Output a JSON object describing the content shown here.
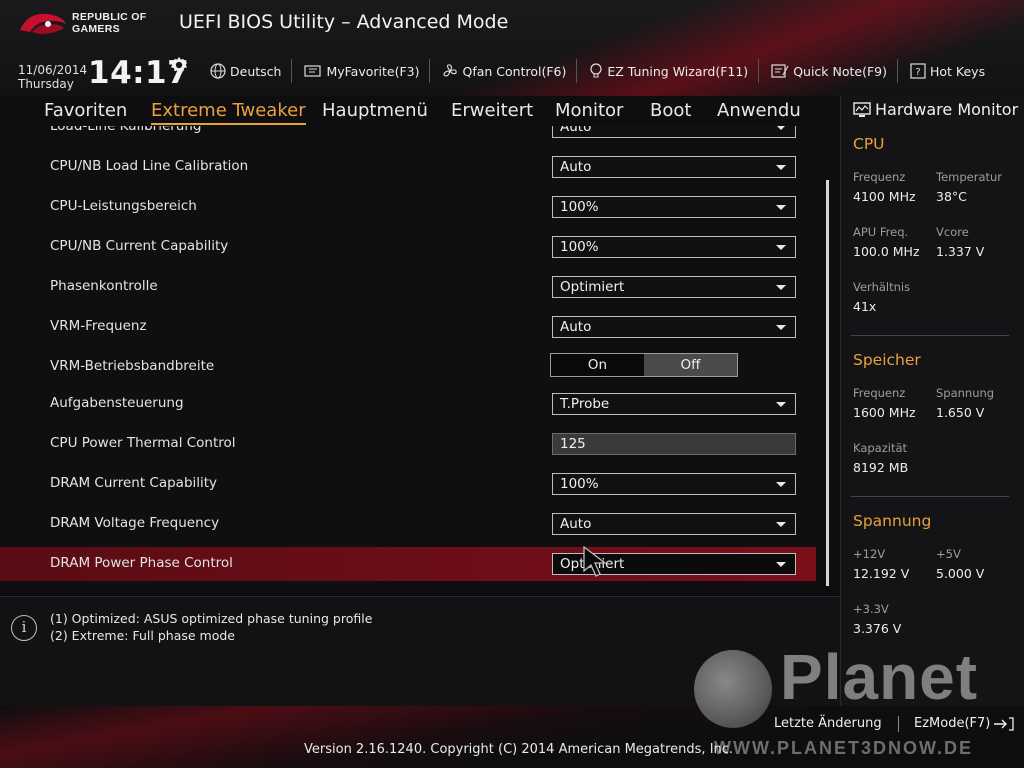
{
  "header": {
    "brand_line1": "REPUBLIC OF",
    "brand_line2": "GAMERS",
    "title": "UEFI BIOS Utility – Advanced Mode",
    "date": "11/06/2014",
    "weekday": "Thursday",
    "time": "14:17",
    "toolbar": [
      {
        "label": "Deutsch",
        "icon": "globe-icon"
      },
      {
        "label": "MyFavorite(F3)",
        "icon": "favorite-icon"
      },
      {
        "label": "Qfan Control(F6)",
        "icon": "fan-icon"
      },
      {
        "label": "EZ Tuning Wizard(F11)",
        "icon": "lightbulb-icon"
      },
      {
        "label": "Quick Note(F9)",
        "icon": "note-icon"
      },
      {
        "label": "Hot Keys",
        "icon": "help-icon"
      }
    ]
  },
  "tabs": [
    {
      "label": "Favoriten"
    },
    {
      "label": "Extreme Tweaker",
      "active": true
    },
    {
      "label": "Hauptmenü"
    },
    {
      "label": "Erweitert"
    },
    {
      "label": "Monitor"
    },
    {
      "label": "Boot"
    },
    {
      "label": "Anwendu"
    }
  ],
  "settings": [
    {
      "label": "Load-Line Kalibrierung",
      "value": "Auto"
    },
    {
      "label": "CPU/NB Load Line Calibration",
      "value": "Auto"
    },
    {
      "label": "CPU-Leistungsbereich",
      "value": "100%"
    },
    {
      "label": "CPU/NB Current Capability",
      "value": "100%"
    },
    {
      "label": "Phasenkontrolle",
      "value": "Optimiert"
    },
    {
      "label": "VRM-Frequenz",
      "value": "Auto"
    },
    {
      "label": "VRM-Betriebsbandbreite",
      "on": "On",
      "off": "Off",
      "selected": "Off"
    },
    {
      "label": "Aufgabensteuerung",
      "value": "T.Probe"
    },
    {
      "label": "CPU Power Thermal Control",
      "value": "125"
    },
    {
      "label": "DRAM Current Capability",
      "value": "100%"
    },
    {
      "label": "DRAM Voltage Frequency",
      "value": "Auto"
    },
    {
      "label": "DRAM Power Phase Control",
      "value": "Optimiert",
      "highlighted": true
    }
  ],
  "help": {
    "line1": "(1) Optimized: ASUS optimized phase tuning profile",
    "line2": "(2) Extreme: Full phase mode",
    "icon_text": "i"
  },
  "hardware_monitor": {
    "title": "Hardware Monitor",
    "cpu": {
      "heading": "CPU",
      "freq_label": "Frequenz",
      "freq": "4100 MHz",
      "temp_label": "Temperatur",
      "temp": "38°C",
      "apu_label": "APU Freq.",
      "apu": "100.0 MHz",
      "vcore_label": "Vcore",
      "vcore": "1.337 V",
      "ratio_label": "Verhältnis",
      "ratio": "41x"
    },
    "memory": {
      "heading": "Speicher",
      "freq_label": "Frequenz",
      "freq": "1600 MHz",
      "volt_label": "Spannung",
      "volt": "1.650 V",
      "cap_label": "Kapazität",
      "cap": "8192 MB"
    },
    "voltage": {
      "heading": "Spannung",
      "v12_label": "+12V",
      "v12": "12.192 V",
      "v5_label": "+5V",
      "v5": "5.000 V",
      "v33_label": "+3.3V",
      "v33": "3.376 V"
    }
  },
  "footer": {
    "last_change": "Letzte Änderung",
    "ezmode": "EzMode(F7)",
    "version": "Version 2.16.1240. Copyright (C) 2014 American Megatrends, Inc.",
    "watermark_text": "Planet",
    "watermark_url": "WWW.PLANET3DNOW.DE"
  },
  "colors": {
    "accent": "#e9a13b",
    "highlight_row": "#7a0f1a",
    "background": "#0f0f11"
  }
}
